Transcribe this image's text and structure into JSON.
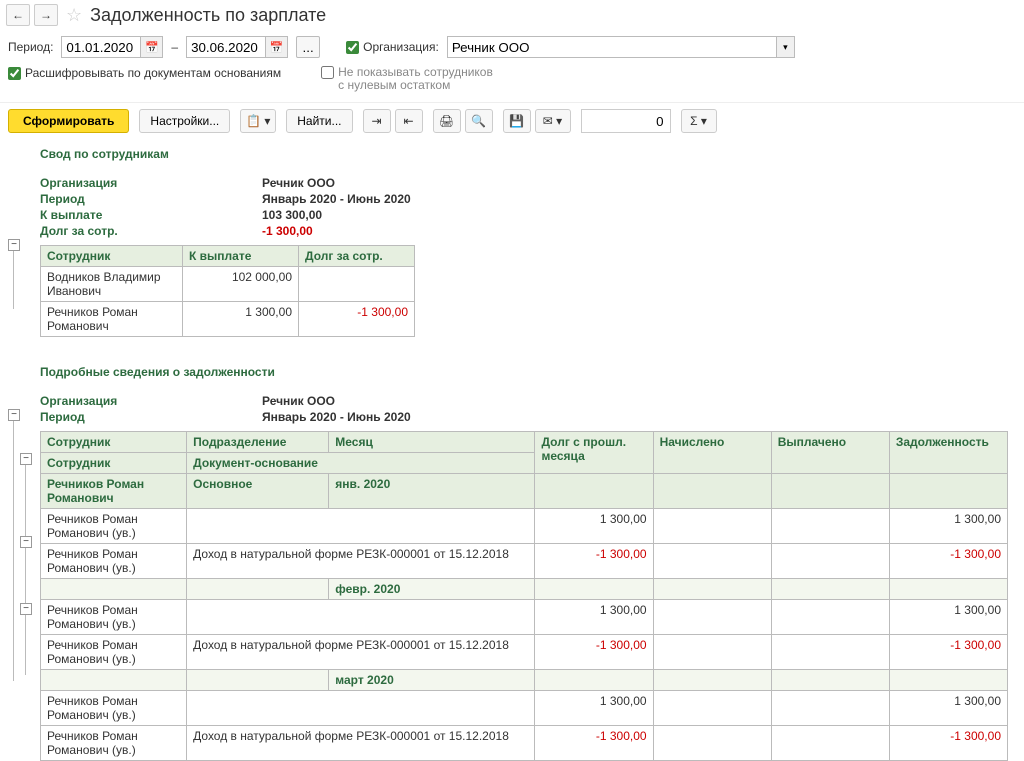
{
  "header": {
    "title": "Задолженность по зарплате"
  },
  "filters": {
    "period_label": "Период:",
    "date_from": "01.01.2020",
    "date_to": "30.06.2020",
    "dash": "–",
    "org_label": "Организация:",
    "org_value": "Речник ООО",
    "chk1": "Расшифровывать по документам основаниям",
    "chk2_l1": "Не показывать сотрудников",
    "chk2_l2": "с нулевым остатком"
  },
  "toolbar": {
    "form": "Сформировать",
    "settings": "Настройки...",
    "find": "Найти...",
    "num_value": "0"
  },
  "svod": {
    "title": "Свод по сотрудникам",
    "org_label": "Организация",
    "org_value": "Речник ООО",
    "period_label": "Период",
    "period_value": "Январь 2020 - Июнь 2020",
    "pay_label": "К выплате",
    "pay_value": "103 300,00",
    "debt_label": "Долг за сотр.",
    "debt_value": "-1 300,00",
    "cols": {
      "emp": "Сотрудник",
      "pay": "К выплате",
      "debt": "Долг за сотр."
    },
    "rows": [
      {
        "emp": "Водников Владимир Иванович",
        "pay": "102 000,00",
        "debt": ""
      },
      {
        "emp": "Речников Роман Романович",
        "pay": "1 300,00",
        "debt": "-1 300,00"
      }
    ]
  },
  "detail": {
    "title": "Подробные сведения о задолженности",
    "org_label": "Организация",
    "org_value": "Речник ООО",
    "period_label": "Период",
    "period_value": "Январь 2020 - Июнь 2020",
    "cols": {
      "emp1": "Сотрудник",
      "dept": "Подразделение",
      "month": "Месяц",
      "prev": "Долг с прошл. месяца",
      "acc": "Начислено",
      "paid": "Выплачено",
      "debt": "Задолженность",
      "emp2": "Сотрудник",
      "doc": "Документ-основание"
    },
    "group": {
      "emp": "Речников Роман Романович",
      "dept": "Основное",
      "month": "янв. 2020"
    },
    "months": [
      "февр. 2020",
      "март 2020"
    ],
    "r1": {
      "emp": "Речников Роман Романович (ув.)",
      "doc": "",
      "prev": "1 300,00",
      "debt": "1 300,00"
    },
    "r2": {
      "emp": "Речников Роман Романович (ув.)",
      "doc": "Доход в натуральной форме РЕЗК-000001 от 15.12.2018",
      "prev": "-1 300,00",
      "debt": "-1 300,00"
    }
  }
}
